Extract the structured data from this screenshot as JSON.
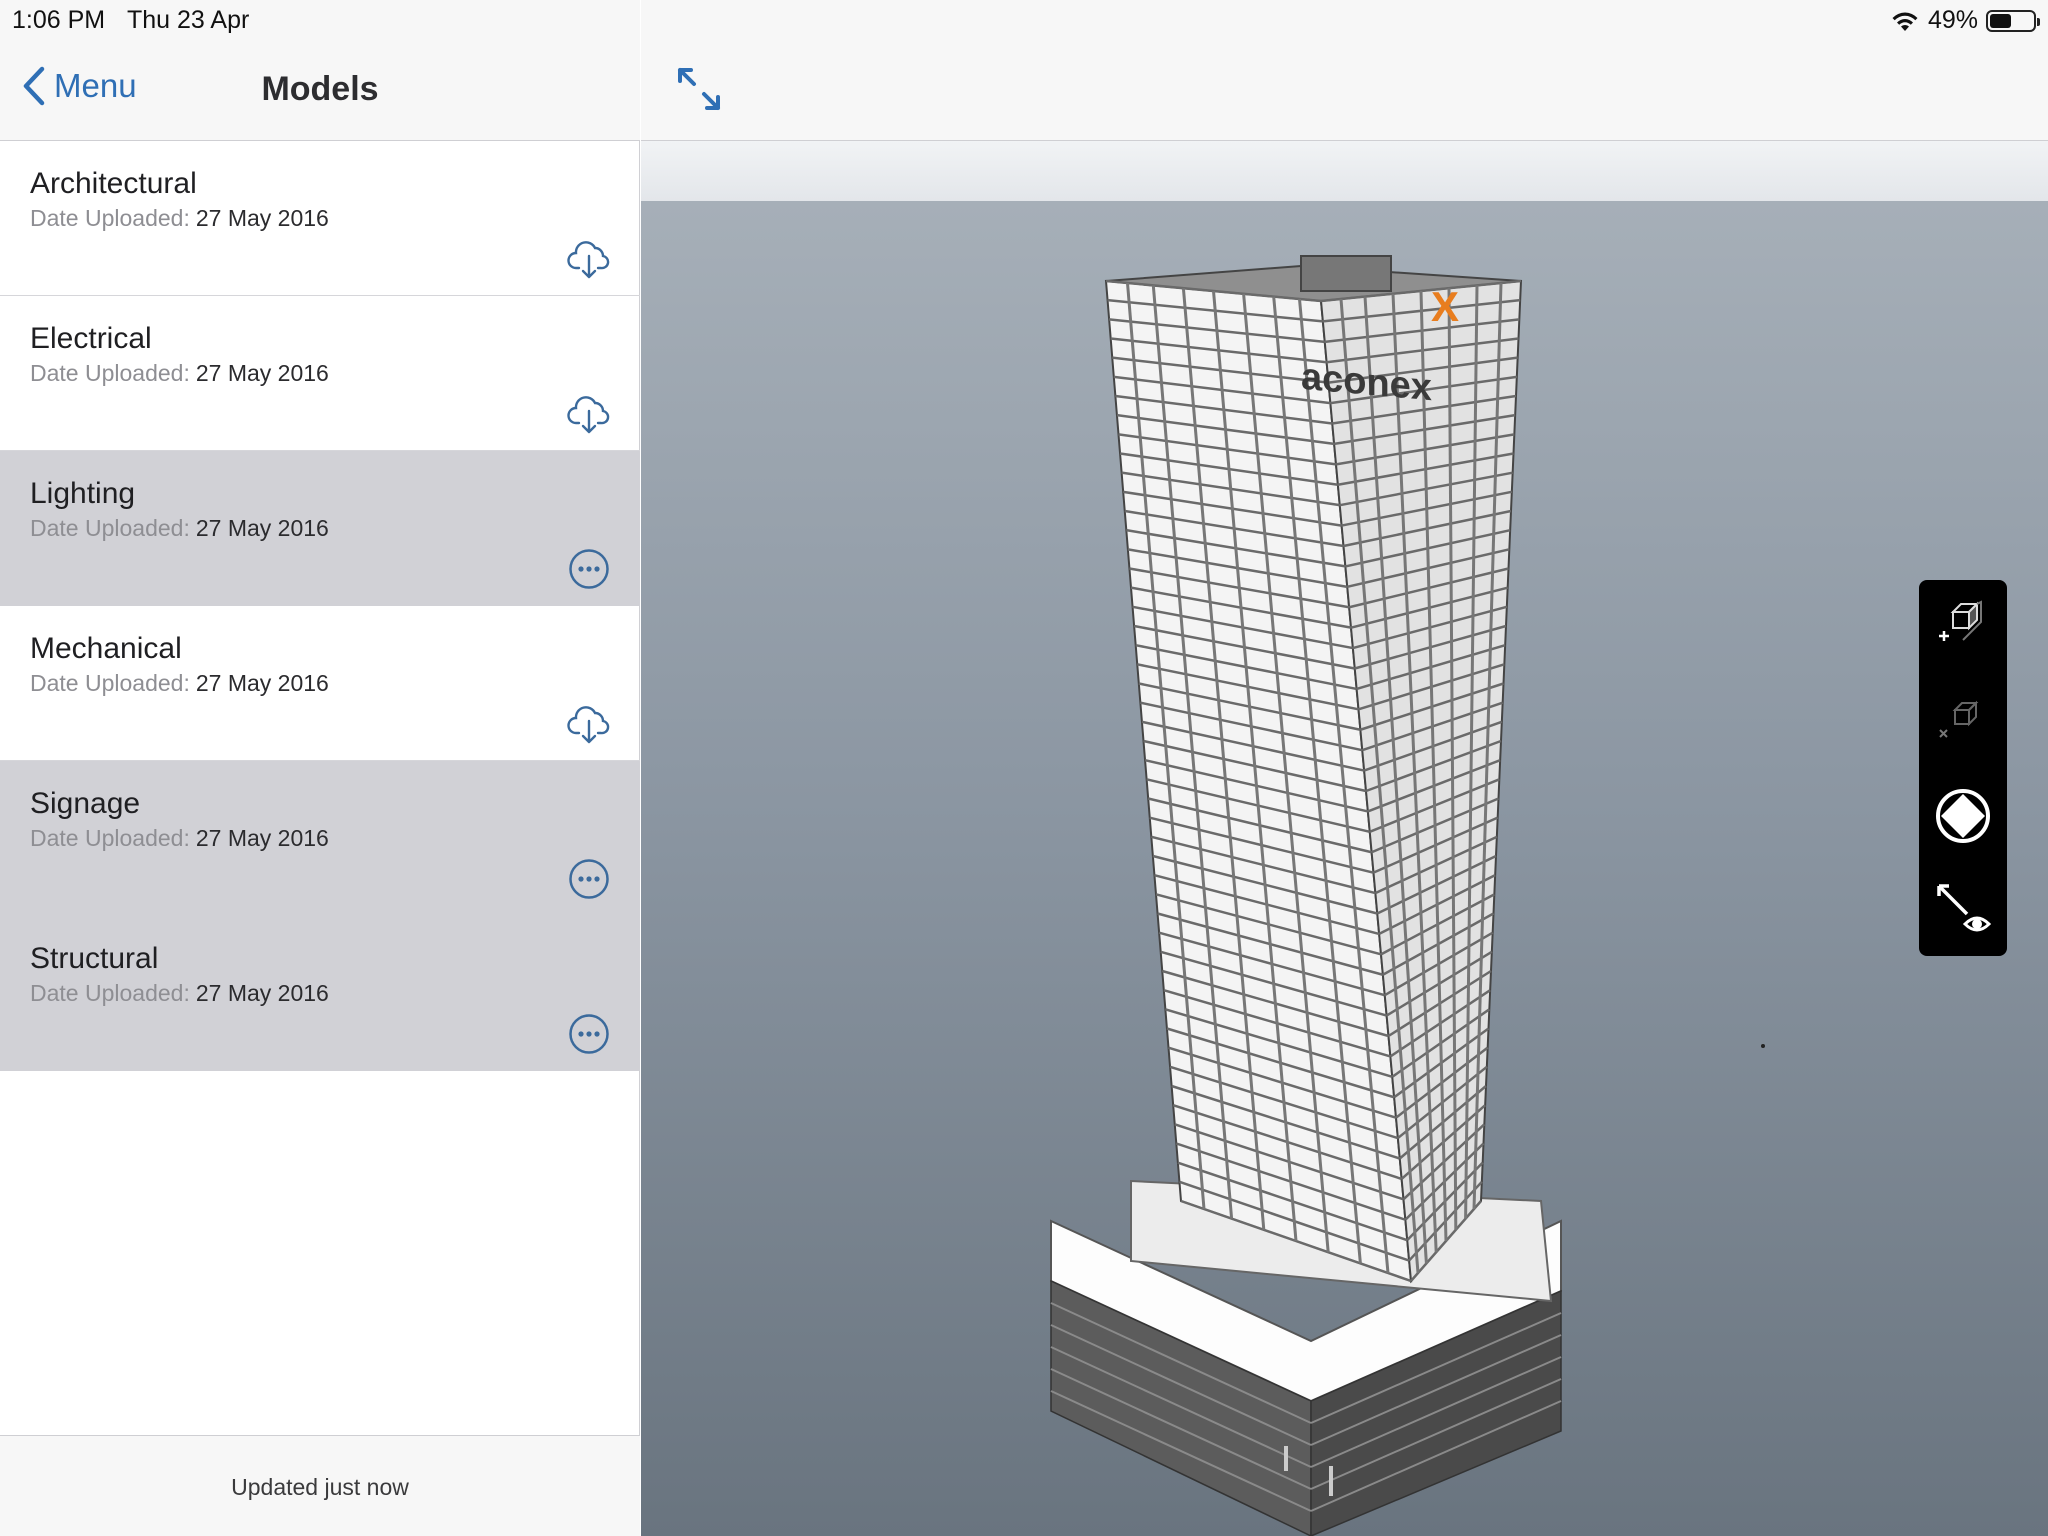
{
  "status_bar": {
    "time": "1:06 PM",
    "date": "Thu 23 Apr",
    "battery": "49%",
    "battery_level": 0.49,
    "wifi_icon": "wifi-icon"
  },
  "nav": {
    "back_label": "Menu",
    "title": "Models"
  },
  "models": [
    {
      "name": "Architectural",
      "date_label": "Date Uploaded:",
      "date": "27 May 2016",
      "state": "download",
      "action_icon": "cloud-download-icon"
    },
    {
      "name": "Electrical",
      "date_label": "Date Uploaded:",
      "date": "27 May 2016",
      "state": "download",
      "action_icon": "cloud-download-icon"
    },
    {
      "name": "Lighting",
      "date_label": "Date Uploaded:",
      "date": "27 May 2016",
      "state": "downloaded",
      "action_icon": "more-icon"
    },
    {
      "name": "Mechanical",
      "date_label": "Date Uploaded:",
      "date": "27 May 2016",
      "state": "download",
      "action_icon": "cloud-download-icon"
    },
    {
      "name": "Signage",
      "date_label": "Date Uploaded:",
      "date": "27 May 2016",
      "state": "downloaded",
      "action_icon": "more-icon"
    },
    {
      "name": "Structural",
      "date_label": "Date Uploaded:",
      "date": "27 May 2016",
      "state": "downloaded",
      "action_icon": "more-icon"
    }
  ],
  "footer": {
    "status": "Updated just now"
  },
  "viewer": {
    "expand_icon": "expand-icon",
    "model_logo_text": "aconex",
    "tools": [
      {
        "name": "add-section-box-icon"
      },
      {
        "name": "remove-section-box-icon"
      },
      {
        "name": "orbit-navigate-icon"
      },
      {
        "name": "walk-look-icon"
      }
    ]
  },
  "colors": {
    "accent": "#2f6fb5",
    "downloaded_row": "#d1d1d6",
    "palette_bg": "#000000",
    "logo_orange": "#e87d1e"
  }
}
